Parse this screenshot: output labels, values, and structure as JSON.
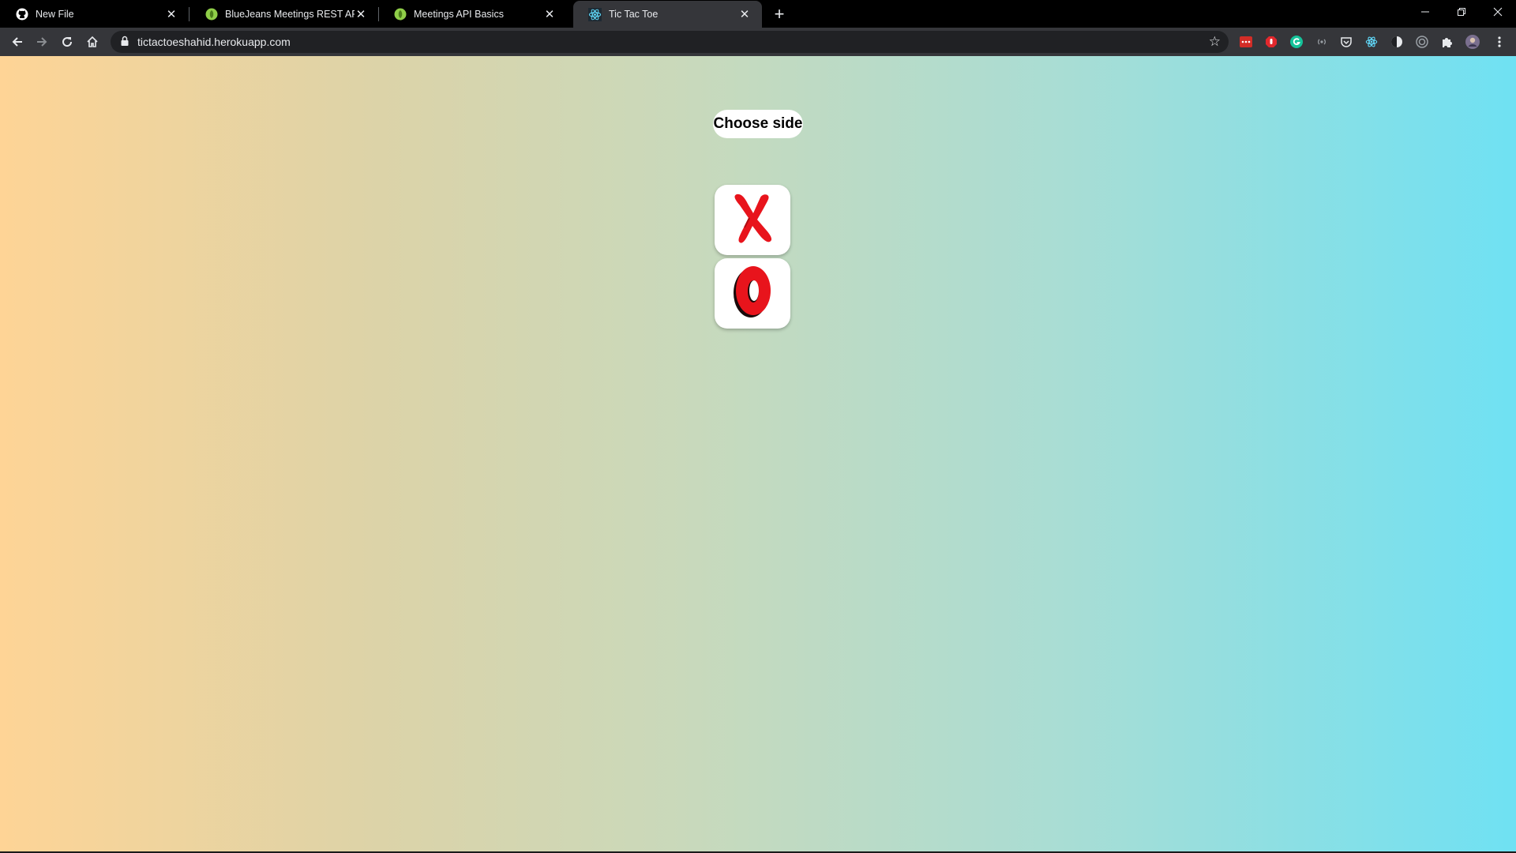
{
  "browser": {
    "tabs": [
      {
        "title": "New File",
        "icon": "github-icon",
        "active": false
      },
      {
        "title": "BlueJeans Meetings REST API's",
        "icon": "api-leaf-icon",
        "active": false
      },
      {
        "title": "Meetings API Basics",
        "icon": "api-leaf-icon",
        "active": false
      },
      {
        "title": "Tic Tac Toe",
        "icon": "react-icon",
        "active": true
      }
    ],
    "url": "tictactoeshahid.herokuapp.com"
  },
  "game": {
    "prompt": "Choose side",
    "options": [
      {
        "symbol": "X",
        "icon": "x-mark-icon",
        "color": "#e8141c"
      },
      {
        "symbol": "O",
        "icon": "o-mark-icon",
        "color": "#e8141c"
      }
    ]
  },
  "colors": {
    "gradient_start": "#fed496",
    "gradient_end": "#6fe1f3"
  }
}
